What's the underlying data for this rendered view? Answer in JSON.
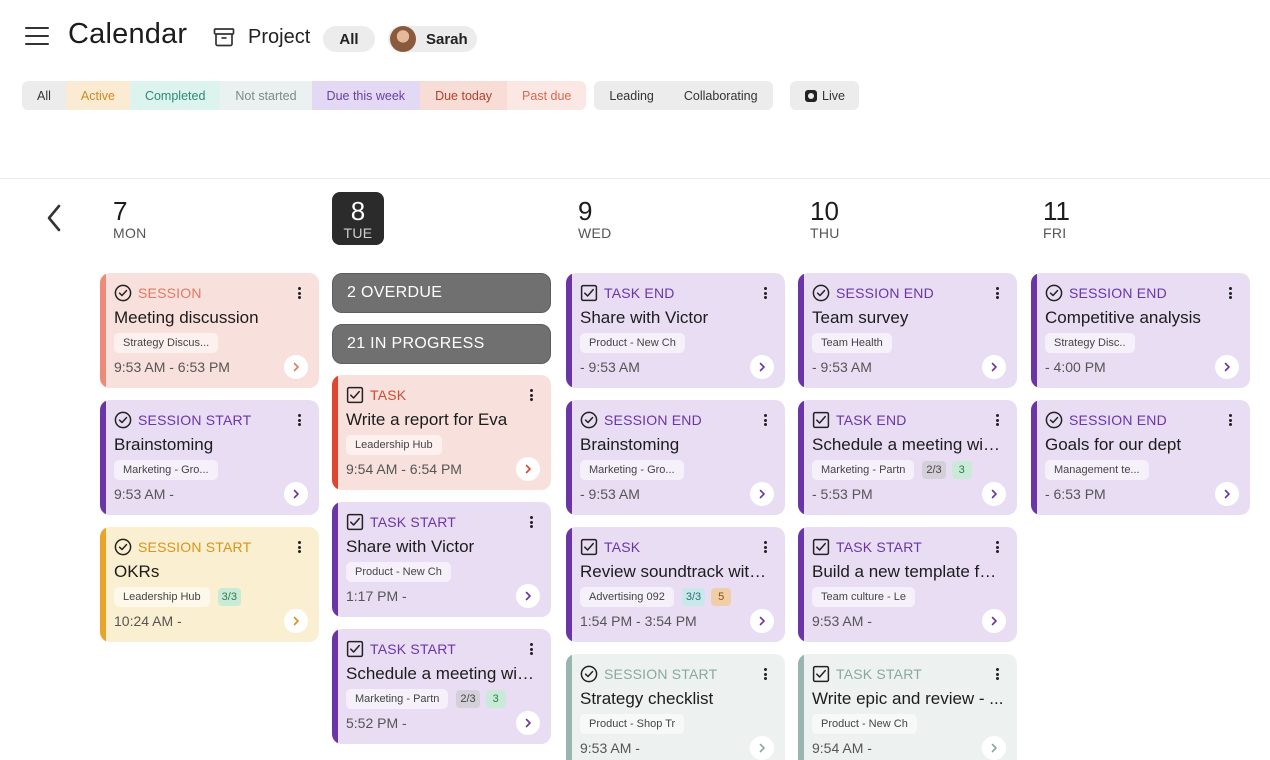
{
  "header": {
    "title": "Calendar",
    "project_label": "Project",
    "all_label": "All",
    "user_name": "Sarah"
  },
  "filters": {
    "status": [
      {
        "label": "All",
        "bg": "#ececec",
        "color": "#333333"
      },
      {
        "label": "Active",
        "bg": "#fcebd3",
        "color": "#d08a1e"
      },
      {
        "label": "Completed",
        "bg": "#dcf3ee",
        "color": "#2e8a78"
      },
      {
        "label": "Not started",
        "bg": "#eaf1f0",
        "color": "#7d8a88"
      },
      {
        "label": "Due this week",
        "bg": "#e4d9f4",
        "color": "#6b3fa0"
      },
      {
        "label": "Due today",
        "bg": "#f8dcd6",
        "color": "#b4412c"
      },
      {
        "label": "Past due",
        "bg": "#fbe7e3",
        "color": "#d9694f"
      }
    ],
    "role": [
      {
        "label": "Leading",
        "bg": "#ececec",
        "color": "#333333"
      },
      {
        "label": "Collaborating",
        "bg": "#ececec",
        "color": "#333333"
      }
    ],
    "live_label": "Live"
  },
  "days": [
    {
      "num": "7",
      "name": "MON"
    },
    {
      "num": "8",
      "name": "TUE"
    },
    {
      "num": "9",
      "name": "WED"
    },
    {
      "num": "10",
      "name": "THU"
    },
    {
      "num": "11",
      "name": "FRI"
    }
  ],
  "summary": {
    "overdue": "2 OVERDUE",
    "in_progress": "21 IN PROGRESS"
  },
  "columns": [
    [
      {
        "kind": "SESSION",
        "icon": "check-circle-icon",
        "title": "Meeting discussion",
        "tags": [
          "Strategy Discus..."
        ],
        "badges": [],
        "time": "9:53 AM - 6:53 PM",
        "theme": "red"
      },
      {
        "kind": "SESSION START",
        "icon": "check-circle-icon",
        "title": "Brainstoming",
        "tags": [
          "Marketing - Gro..."
        ],
        "badges": [],
        "time": "9:53 AM -",
        "theme": "purple"
      },
      {
        "kind": "SESSION START",
        "icon": "check-circle-icon",
        "title": "OKRs",
        "tags": [
          "Leadership Hub"
        ],
        "badges": [
          {
            "text": "3/3",
            "tone": "green"
          }
        ],
        "time": "10:24 AM -",
        "theme": "yellow"
      }
    ],
    [
      {
        "kind": "TASK",
        "icon": "checkbox-icon",
        "title": "Write a report for Eva",
        "tags": [
          "Leadership Hub"
        ],
        "badges": [],
        "time": "9:54 AM - 6:54 PM",
        "theme": "red"
      },
      {
        "kind": "TASK START",
        "icon": "checkbox-icon",
        "title": "Share with Victor",
        "tags": [
          "Product - New Ch"
        ],
        "badges": [],
        "time": "1:17 PM -",
        "theme": "purple"
      },
      {
        "kind": "TASK START",
        "icon": "checkbox-icon",
        "title": "Schedule a meeting with...",
        "tags": [
          "Marketing - Partn"
        ],
        "badges": [
          {
            "text": "2/3",
            "tone": "gray"
          },
          {
            "text": "3",
            "tone": "green"
          }
        ],
        "time": "5:52 PM -",
        "theme": "purple"
      }
    ],
    [
      {
        "kind": "TASK END",
        "icon": "checkbox-icon",
        "title": "Share with Victor",
        "tags": [
          "Product - New Ch"
        ],
        "badges": [],
        "time": "- 9:53 AM",
        "theme": "purple"
      },
      {
        "kind": "SESSION END",
        "icon": "check-circle-icon",
        "title": "Brainstoming",
        "tags": [
          "Marketing - Gro..."
        ],
        "badges": [],
        "time": "- 9:53 AM",
        "theme": "purple"
      },
      {
        "kind": "TASK",
        "icon": "checkbox-icon",
        "title": "Review soundtrack with ...",
        "tags": [
          "Advertising 092"
        ],
        "badges": [
          {
            "text": "3/3",
            "tone": "teal"
          },
          {
            "text": "5",
            "tone": "orange"
          }
        ],
        "time": "1:54 PM - 3:54 PM",
        "theme": "purple"
      },
      {
        "kind": "SESSION START",
        "icon": "check-circle-icon",
        "title": "Strategy checklist",
        "tags": [
          "Product - Shop Tr"
        ],
        "badges": [],
        "time": "9:53 AM -",
        "theme": "gray"
      }
    ],
    [
      {
        "kind": "SESSION END",
        "icon": "check-circle-icon",
        "title": "Team survey",
        "tags": [
          "Team Health"
        ],
        "badges": [],
        "time": "- 9:53 AM",
        "theme": "purple"
      },
      {
        "kind": "TASK END",
        "icon": "checkbox-icon",
        "title": "Schedule a meeting with...",
        "tags": [
          "Marketing - Partn"
        ],
        "badges": [
          {
            "text": "2/3",
            "tone": "gray"
          },
          {
            "text": "3",
            "tone": "green"
          }
        ],
        "time": "- 5:53 PM",
        "theme": "purple"
      },
      {
        "kind": "TASK START",
        "icon": "checkbox-icon",
        "title": "Build a new template for...",
        "tags": [
          "Team culture - Le"
        ],
        "badges": [],
        "time": "9:53 AM -",
        "theme": "purple"
      },
      {
        "kind": "TASK START",
        "icon": "checkbox-icon",
        "title": "Write epic and review - ...",
        "tags": [
          "Product - New Ch"
        ],
        "badges": [],
        "time": "9:54 AM -",
        "theme": "gray"
      }
    ],
    [
      {
        "kind": "SESSION END",
        "icon": "check-circle-icon",
        "title": "Competitive analysis",
        "tags": [
          "Strategy Disc.."
        ],
        "badges": [],
        "time": "- 4:00 PM",
        "theme": "purple"
      },
      {
        "kind": "SESSION END",
        "icon": "check-circle-icon",
        "title": "Goals for our dept",
        "tags": [
          "Management te..."
        ],
        "badges": [],
        "time": "- 6:53 PM",
        "theme": "purple"
      }
    ]
  ],
  "themes": {
    "red": {
      "bg": "#f8e0dc",
      "bar": "#f08a78",
      "accent": "#e07a62"
    },
    "purple": {
      "bg": "#e8ddf3",
      "bar": "#6b35a8",
      "accent": "#6b35a8"
    },
    "yellow": {
      "bg": "#fbefd1",
      "bar": "#e8a52a",
      "accent": "#d99416"
    },
    "gray": {
      "bg": "#edf2f1",
      "bar": "#9ab4af",
      "accent": "#8aa7a1"
    },
    "task_red": {
      "bg": "#f8e0dc",
      "bar": "#e0452f",
      "accent": "#d44a33"
    }
  },
  "badge_tones": {
    "green": {
      "bg": "#c9ead7",
      "color": "#2f7a4d"
    },
    "gray": {
      "bg": "#d4d0da",
      "color": "#444444"
    },
    "teal": {
      "bg": "#c8e8ec",
      "color": "#2d6f78"
    },
    "orange": {
      "bg": "#f0cfa8",
      "color": "#8a4f12"
    }
  }
}
